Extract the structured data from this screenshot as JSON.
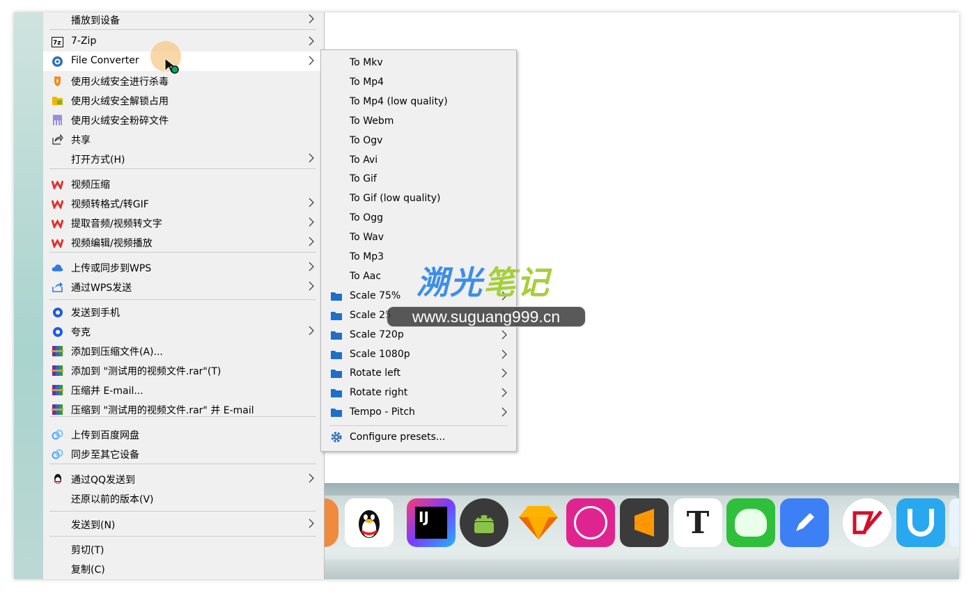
{
  "main_menu": {
    "items": [
      {
        "label": "播放到设备",
        "has_submenu": true
      },
      {
        "label": "7-Zip",
        "has_submenu": true,
        "icon": "7zip-icon"
      },
      {
        "label": "File Converter",
        "has_submenu": true,
        "icon": "file-converter-icon",
        "highlighted": true
      },
      {
        "label": "使用火绒安全进行杀毒",
        "icon": "huorong-icon"
      },
      {
        "label": "使用火绒安全解锁占用",
        "icon": "unlock-folder-icon"
      },
      {
        "label": "使用火绒安全粉碎文件",
        "icon": "shredder-icon"
      },
      {
        "label": "共享",
        "icon": "share-icon"
      },
      {
        "label": "打开方式(H)",
        "has_submenu": true
      },
      {
        "label": "视频压缩",
        "icon": "wps-icon"
      },
      {
        "label": "视频转格式/转GIF",
        "has_submenu": true,
        "icon": "wps-icon"
      },
      {
        "label": "提取音频/视频转文字",
        "has_submenu": true,
        "icon": "wps-icon"
      },
      {
        "label": "视频编辑/视频播放",
        "has_submenu": true,
        "icon": "wps-icon"
      },
      {
        "label": "上传或同步到WPS",
        "has_submenu": true,
        "icon": "cloud-icon"
      },
      {
        "label": "通过WPS发送",
        "has_submenu": true,
        "icon": "send-icon"
      },
      {
        "label": "发送到手机",
        "icon": "quark-icon"
      },
      {
        "label": "夸克",
        "has_submenu": true,
        "icon": "quark-icon"
      },
      {
        "label": "添加到压缩文件(A)...",
        "icon": "winrar-icon"
      },
      {
        "label": "添加到 \"测试用的视频文件.rar\"(T)",
        "icon": "winrar-icon"
      },
      {
        "label": "压缩并 E-mail...",
        "icon": "winrar-icon"
      },
      {
        "label": "压缩到 \"测试用的视频文件.rar\" 并 E-mail",
        "icon": "winrar-icon"
      },
      {
        "label": "上传到百度网盘",
        "icon": "baidu-pan-icon"
      },
      {
        "label": "同步至其它设备",
        "icon": "baidu-pan-icon"
      },
      {
        "label": "通过QQ发送到",
        "has_submenu": true,
        "icon": "qq-icon"
      },
      {
        "label": "还原以前的版本(V)"
      },
      {
        "label": "发送到(N)",
        "has_submenu": true
      },
      {
        "label": "剪切(T)"
      },
      {
        "label": "复制(C)"
      }
    ]
  },
  "submenu": {
    "items": [
      {
        "label": "To Mkv"
      },
      {
        "label": "To Mp4"
      },
      {
        "label": "To Mp4 (low quality)"
      },
      {
        "label": "To Webm"
      },
      {
        "label": "To Ogv"
      },
      {
        "label": "To Avi"
      },
      {
        "label": "To Gif"
      },
      {
        "label": "To Gif (low quality)"
      },
      {
        "label": "To Ogg"
      },
      {
        "label": "To Wav"
      },
      {
        "label": "To Mp3"
      },
      {
        "label": "To Aac"
      },
      {
        "label": "Scale 75%",
        "folder": true
      },
      {
        "label": "Scale 25",
        "folder": true
      },
      {
        "label": "Scale 720p",
        "folder": true
      },
      {
        "label": "Scale 1080p",
        "folder": true
      },
      {
        "label": "Rotate left",
        "folder": true
      },
      {
        "label": "Rotate right",
        "folder": true
      },
      {
        "label": "Tempo - Pitch",
        "folder": true
      },
      {
        "label": "Configure presets...",
        "icon": "gear-icon"
      }
    ]
  },
  "watermark": {
    "title_a": "溯光",
    "title_b": "笔记",
    "url": "www.suguang999.cn"
  },
  "dock": {
    "apps": [
      "qq",
      "intellij-idea",
      "android-studio",
      "sketch",
      "pinbo",
      "sublime-text",
      "typora",
      "android-app",
      "notes-app",
      "xmind",
      "vpn"
    ]
  },
  "colors": {
    "menu_bg": "#f0f0f0",
    "highlight_bg": "#ffffff",
    "folder_blue": "#1e6fc7",
    "wps_red": "#e0322b"
  }
}
